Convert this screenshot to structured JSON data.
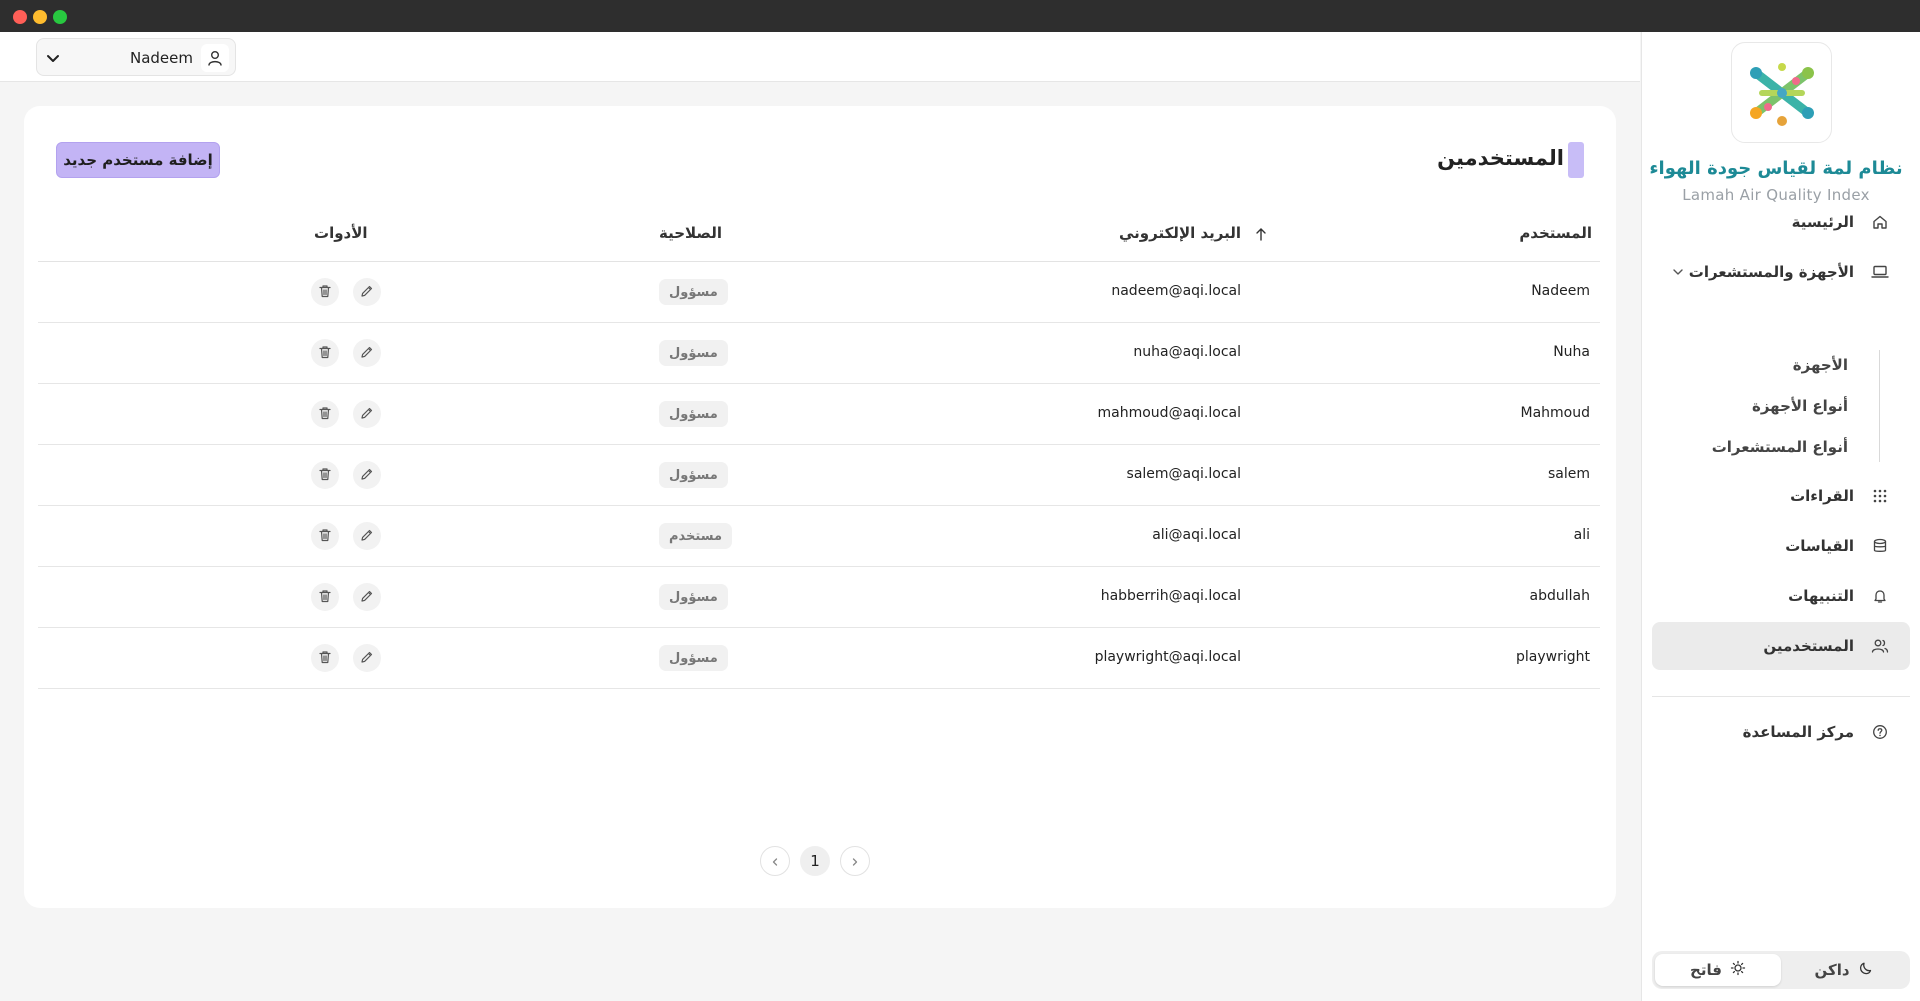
{
  "header": {
    "user_name": "Nadeem"
  },
  "sidebar": {
    "brand_title": "نظام لمة لقياس جودة الهواء",
    "brand_subtitle": "Lamah Air Quality Index",
    "items": {
      "home": {
        "label": "الرئيسية",
        "icon": "home-icon"
      },
      "devices_sensors": {
        "label": "الأجهزة والمستشعرات",
        "icon": "laptop-icon",
        "expanded": true
      },
      "readings": {
        "label": "القراءات",
        "icon": "grid-icon"
      },
      "measurements": {
        "label": "القياسات",
        "icon": "database-icon"
      },
      "alerts": {
        "label": "التنبيهات",
        "icon": "bell-icon"
      },
      "users": {
        "label": "المستخدمين",
        "icon": "users-icon",
        "active": true
      },
      "help": {
        "label": "مركز المساعدة",
        "icon": "help-circle-icon"
      }
    },
    "subitems": {
      "devices": "الأجهزة",
      "device_types": "أنواع الأجهزة",
      "sensor_types": "أنواع المستشعرات"
    },
    "theme": {
      "light_label": "فاتح",
      "dark_label": "داكن",
      "selected": "light"
    }
  },
  "page": {
    "title": "المستخدمين",
    "add_button": "إضافة مستخدم جديد",
    "accent_color": "#c3b4f5"
  },
  "table": {
    "columns": {
      "user": "المستخدم",
      "email": "البريد الإلكتروني",
      "role": "الصلاحية",
      "tools": "الأدوات"
    },
    "sorted_column": "email",
    "rows": [
      {
        "user": "Nadeem",
        "email": "nadeem@aqi.local",
        "role": "مسؤول"
      },
      {
        "user": "Nuha",
        "email": "nuha@aqi.local",
        "role": "مسؤول"
      },
      {
        "user": "Mahmoud",
        "email": "mahmoud@aqi.local",
        "role": "مسؤول"
      },
      {
        "user": "salem",
        "email": "salem@aqi.local",
        "role": "مسؤول"
      },
      {
        "user": "ali",
        "email": "ali@aqi.local",
        "role": "مستخدم"
      },
      {
        "user": "abdullah",
        "email": "habberrih@aqi.local",
        "role": "مسؤول"
      },
      {
        "user": "playwright",
        "email": "playwright@aqi.local",
        "role": "مسؤول"
      }
    ]
  },
  "pagination": {
    "current_page": "1"
  }
}
